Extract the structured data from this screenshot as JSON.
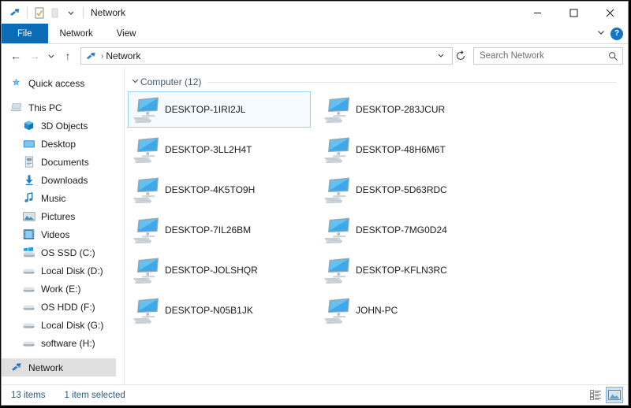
{
  "window": {
    "title": "Network",
    "quick_access": [
      "network-icon",
      "properties-icon",
      "new-folder-icon",
      "customize-chevron-icon"
    ],
    "controls": {
      "minimize": "—",
      "maximize": "☐",
      "close": "✕"
    }
  },
  "ribbon": {
    "tabs": [
      {
        "label": "File",
        "active": true
      },
      {
        "label": "Network",
        "active": false
      },
      {
        "label": "View",
        "active": false
      }
    ],
    "collapse_chevron": "⌄",
    "help_label": "?"
  },
  "address": {
    "back": "←",
    "forward": "→",
    "recent": "⌄",
    "up": "↑",
    "separator": "›",
    "path": "Network",
    "dropdown": "⌄",
    "refresh": "⟳"
  },
  "search": {
    "placeholder": "Search Network",
    "value": ""
  },
  "sidebar": {
    "items": [
      {
        "label": "Quick access",
        "icon": "star-icon",
        "level": 0,
        "selected": false
      },
      {
        "label": "This PC",
        "icon": "this-pc-icon",
        "level": 0,
        "selected": false
      },
      {
        "label": "3D Objects",
        "icon": "3d-objects-icon",
        "level": 1,
        "selected": false
      },
      {
        "label": "Desktop",
        "icon": "desktop-icon",
        "level": 1,
        "selected": false
      },
      {
        "label": "Documents",
        "icon": "documents-icon",
        "level": 1,
        "selected": false
      },
      {
        "label": "Downloads",
        "icon": "downloads-icon",
        "level": 1,
        "selected": false
      },
      {
        "label": "Music",
        "icon": "music-icon",
        "level": 1,
        "selected": false
      },
      {
        "label": "Pictures",
        "icon": "pictures-icon",
        "level": 1,
        "selected": false
      },
      {
        "label": "Videos",
        "icon": "videos-icon",
        "level": 1,
        "selected": false
      },
      {
        "label": "OS SSD (C:)",
        "icon": "windows-drive-icon",
        "level": 1,
        "selected": false
      },
      {
        "label": "Local Disk (D:)",
        "icon": "drive-icon",
        "level": 1,
        "selected": false
      },
      {
        "label": "Work (E:)",
        "icon": "drive-icon",
        "level": 1,
        "selected": false
      },
      {
        "label": "OS HDD (F:)",
        "icon": "drive-icon",
        "level": 1,
        "selected": false
      },
      {
        "label": "Local Disk (G:)",
        "icon": "drive-icon",
        "level": 1,
        "selected": false
      },
      {
        "label": "software (H:)",
        "icon": "drive-icon",
        "level": 1,
        "selected": false
      },
      {
        "label": "Network",
        "icon": "network-icon",
        "level": 0,
        "selected": true
      }
    ]
  },
  "main": {
    "group": {
      "label": "Computer (12)",
      "chevron": "⌄",
      "expanded": true
    },
    "items": [
      {
        "name": "DESKTOP-1IRI2JL",
        "icon": "computer-icon",
        "selected": true
      },
      {
        "name": "DESKTOP-283JCUR",
        "icon": "computer-icon",
        "selected": false
      },
      {
        "name": "DESKTOP-3LL2H4T",
        "icon": "computer-icon",
        "selected": false
      },
      {
        "name": "DESKTOP-48H6M6T",
        "icon": "computer-icon",
        "selected": false
      },
      {
        "name": "DESKTOP-4K5TO9H",
        "icon": "computer-icon",
        "selected": false
      },
      {
        "name": "DESKTOP-5D63RDC",
        "icon": "computer-icon",
        "selected": false
      },
      {
        "name": "DESKTOP-7IL26BM",
        "icon": "computer-icon",
        "selected": false
      },
      {
        "name": "DESKTOP-7MG0D24",
        "icon": "computer-icon",
        "selected": false
      },
      {
        "name": "DESKTOP-JOLSHQR",
        "icon": "computer-icon",
        "selected": false
      },
      {
        "name": "DESKTOP-KFLN3RC",
        "icon": "computer-icon",
        "selected": false
      },
      {
        "name": "DESKTOP-N05B1JK",
        "icon": "computer-icon",
        "selected": false
      },
      {
        "name": "JOHN-PC",
        "icon": "computer-icon",
        "selected": false
      }
    ]
  },
  "status": {
    "item_count": "13 items",
    "selection": "1 item selected",
    "views": [
      {
        "name": "details-view-button",
        "active": false
      },
      {
        "name": "large-icons-view-button",
        "active": true
      }
    ]
  },
  "colors": {
    "accent": "#0b6cb5",
    "selection_border": "#99d1ff",
    "group_text": "#3d5a73",
    "status_text": "#2a5a86"
  }
}
